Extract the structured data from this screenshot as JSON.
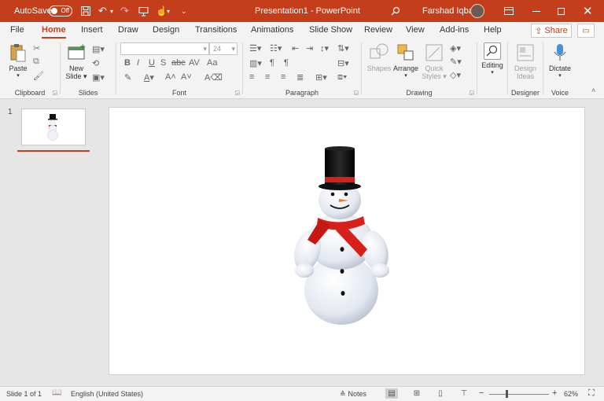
{
  "titlebar": {
    "autosave_label": "AutoSave",
    "autosave_state": "Off",
    "document_title": "Presentation1 - PowerPoint",
    "user_name": "Farshad Iqbal",
    "icons": [
      "save-icon",
      "undo-icon",
      "redo-icon",
      "present-icon",
      "touch-mode-icon",
      "customize-qat-icon",
      "search-icon",
      "ribbon-display-icon",
      "minimize-icon",
      "maximize-icon",
      "close-icon"
    ]
  },
  "tabs": [
    {
      "label": "File"
    },
    {
      "label": "Home"
    },
    {
      "label": "Insert"
    },
    {
      "label": "Draw"
    },
    {
      "label": "Design"
    },
    {
      "label": "Transitions"
    },
    {
      "label": "Animations"
    },
    {
      "label": "Slide Show"
    },
    {
      "label": "Review"
    },
    {
      "label": "View"
    },
    {
      "label": "Add-ins"
    },
    {
      "label": "Help"
    }
  ],
  "active_tab": "Home",
  "share_label": "Share",
  "ribbon": {
    "clipboard": {
      "label": "Clipboard",
      "paste": "Paste"
    },
    "slides": {
      "label": "Slides",
      "new_slide_line1": "New",
      "new_slide_line2": "Slide"
    },
    "font": {
      "label": "Font",
      "font_size": "24"
    },
    "paragraph": {
      "label": "Paragraph"
    },
    "drawing": {
      "label": "Drawing",
      "shapes": "Shapes",
      "arrange": "Arrange",
      "quick_styles_line1": "Quick",
      "quick_styles_line2": "Styles"
    },
    "editing": {
      "label": "Editing"
    },
    "designer": {
      "label": "Designer",
      "design_ideas_line1": "Design",
      "design_ideas_line2": "Ideas"
    },
    "voice": {
      "label": "Voice",
      "dictate": "Dictate"
    }
  },
  "thumbnails": [
    {
      "number": "1"
    }
  ],
  "status": {
    "slide_info": "Slide 1 of 1",
    "language": "English (United States)",
    "notes_label": "Notes",
    "zoom_percent": "62%",
    "zoom_level": 0.62
  },
  "colors": {
    "accent": "#c43e1c",
    "ribbon_bg": "#f3f3f3",
    "workspace_bg": "#e6e6e6"
  }
}
